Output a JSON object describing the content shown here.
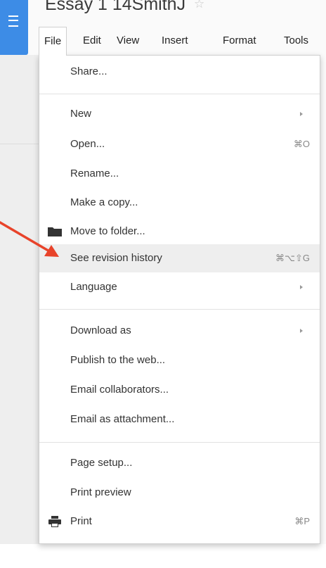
{
  "document": {
    "title": "Essay 1 14SmithJ"
  },
  "menubar": {
    "items": [
      {
        "label": "File",
        "active": true
      },
      {
        "label": "Edit"
      },
      {
        "label": "View"
      },
      {
        "label": "Insert"
      },
      {
        "label": "Format"
      },
      {
        "label": "Tools"
      }
    ]
  },
  "file_menu": {
    "items": [
      {
        "label": "Share..."
      },
      {
        "label": "New",
        "submenu": true
      },
      {
        "label": "Open...",
        "shortcut": "⌘O"
      },
      {
        "label": "Rename..."
      },
      {
        "label": "Make a copy..."
      },
      {
        "label": "Move to folder...",
        "icon": "folder-icon"
      },
      {
        "label": "See revision history",
        "shortcut": "⌘⌥⇧G",
        "highlighted": true
      },
      {
        "label": "Language",
        "submenu": true
      },
      {
        "label": "Download as",
        "submenu": true
      },
      {
        "label": "Publish to the web..."
      },
      {
        "label": "Email collaborators..."
      },
      {
        "label": "Email as attachment..."
      },
      {
        "label": "Page setup..."
      },
      {
        "label": "Print preview"
      },
      {
        "label": "Print",
        "shortcut": "⌘P",
        "icon": "printer-icon"
      }
    ]
  },
  "colors": {
    "app_blue": "#3d8ce6",
    "highlight": "#eeeeee",
    "annotation_arrow": "#e8432a"
  },
  "annotation": {
    "target": "See revision history"
  }
}
